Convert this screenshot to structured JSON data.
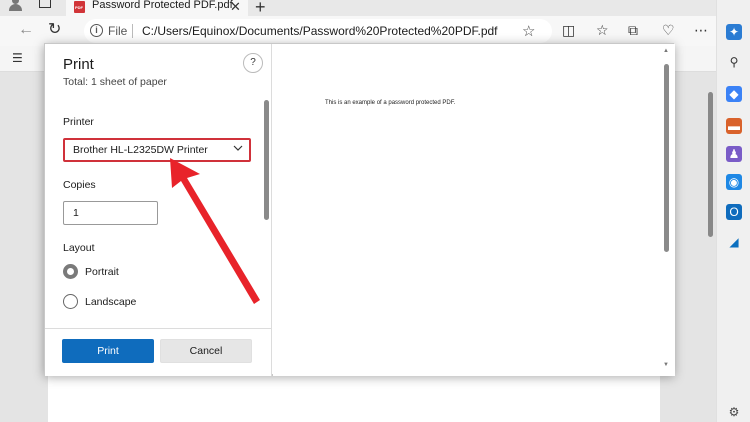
{
  "browser": {
    "tab_title": "Password Protected PDF.pdf",
    "tab_close": "✕",
    "new_tab": "+",
    "address": {
      "scheme_label": "File",
      "url": "C:/Users/Equinox/Documents/Password%20Protected%20PDF.pdf"
    }
  },
  "print_dialog": {
    "title": "Print",
    "subtitle": "Total: 1 sheet of paper",
    "help": "?",
    "printer_label": "Printer",
    "printer_value": "Brother HL-L2325DW Printer",
    "copies_label": "Copies",
    "copies_value": "1",
    "layout_label": "Layout",
    "layout_options": [
      {
        "label": "Portrait",
        "selected": true
      },
      {
        "label": "Landscape",
        "selected": false
      }
    ],
    "print_button": "Print",
    "cancel_button": "Cancel"
  },
  "preview": {
    "page_text": "This is an example of a password protected PDF."
  },
  "colors": {
    "accent": "#0f6cbd",
    "highlight": "#d0313a",
    "annotation_arrow": "#e8232a"
  }
}
